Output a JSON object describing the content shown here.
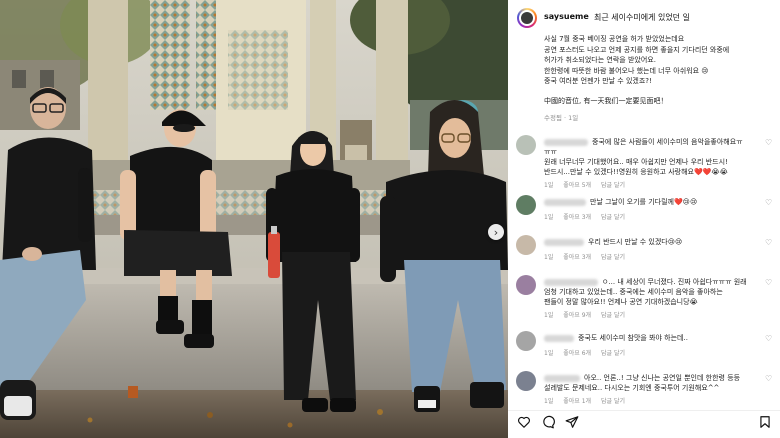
{
  "post": {
    "username": "saysueme",
    "header_caption": "최근 세이수미에게 있었던 일",
    "caption_lines": [
      "사실 7월 중국 베이징 공연을 허가 받았었는데요",
      "공연 포스터도 나오고 언제 공지를 하면 좋을지 기다리던 와중에",
      "허가가 취소되었다는 연락을 받았어요.",
      "한한령에 따뜻한 바람 불어오나 했는데 너무 아쉬워요 😢",
      "중국 여러분 언젠가 만날 수 있겠죠?!"
    ],
    "caption_chinese": "中國的音位, 有一天我们一定要见面吧！",
    "meta": "수정됨 · 1일"
  },
  "comments": [
    {
      "lines": [
        "중국에 많은 사람들이 세이수미의 음악을좋아해요ㅠ",
        "ㅠㅠ",
        "원래 너무너무 기대했어요.. 매우 아쉽지만 언제나 우리 반드시!",
        "반드시...만날 수 있겠다!!영원히 응원하고 사랑해요❤️❤️😭😭"
      ],
      "time": "1일",
      "likes": "좋아요 5개",
      "reply": "답글 달기",
      "avatar_color": "#b9c1b7"
    },
    {
      "lines": [
        "만날 그날이 오기를 기다릴께❤️😢😢"
      ],
      "time": "1일",
      "likes": "좋아요 3개",
      "reply": "답글 달기",
      "avatar_color": "#5f7d63"
    },
    {
      "lines": [
        "우리 반드시 만날 수 있겠다😢😢"
      ],
      "time": "1일",
      "likes": "좋아요 3개",
      "reply": "답글 달기",
      "avatar_color": "#c7b9a8"
    },
    {
      "lines": [
        "ㅇ... 내 세상이 무너졌다. 진짜 아쉽다ㅠㅠㅠ 원래",
        "엄청 기대하고 있었는데.. 중국에는 세이수미 음악을 좋아하는",
        "팬들이 정말 많아요!! 언제나 공연 기대하겠습니당😭"
      ],
      "time": "1일",
      "likes": "좋아요 9개",
      "reply": "답글 달기",
      "avatar_color": "#9a7fa0"
    },
    {
      "lines": [
        "중국도 세이수미 참맛을 봐야 하는데.."
      ],
      "time": "1일",
      "likes": "좋아요 6개",
      "reply": "답글 달기",
      "avatar_color": "#a5a5a5"
    },
    {
      "lines": [
        "아오.. 언론..! 그냥 신나는 공연일 뿐인데 한한령 등등",
        "설레발도 문제네요.. 다시오는 기회엔 중국투어 기원해요^^"
      ],
      "time": "1일",
      "likes": "좋아요 1개",
      "reply": "답글 달기",
      "avatar_color": "#7b8190"
    }
  ],
  "icons": {
    "like": "heart-icon",
    "comment": "comment-icon",
    "share": "share-icon",
    "save": "bookmark-icon",
    "next": "chevron-right-icon"
  },
  "nav": {
    "next_glyph": "›"
  },
  "colors": {
    "meta_gray": "#8e8e8e",
    "text": "#222222"
  }
}
